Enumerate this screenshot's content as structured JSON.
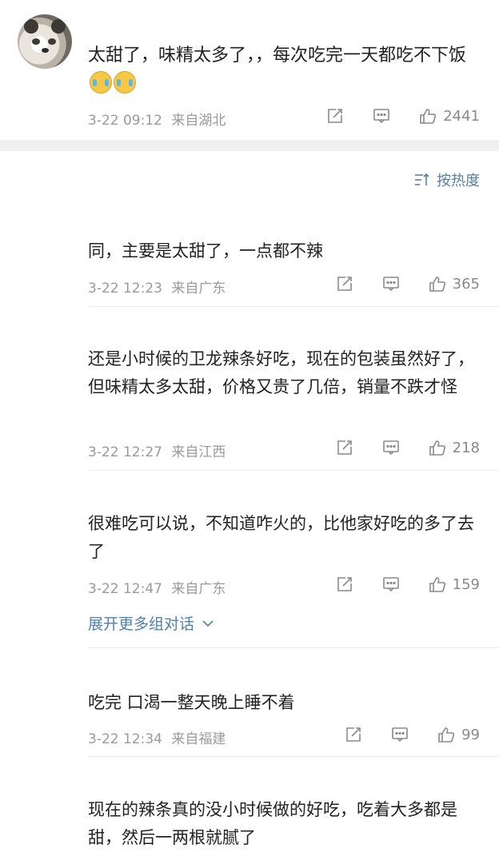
{
  "main_comment": {
    "text": "太甜了，味精太多了，，每次吃完一天都吃不下饭",
    "emoji": [
      "crying-laughing-emoji",
      "crying-laughing-emoji"
    ],
    "time": "3-22 09:12",
    "location": "来自湖北",
    "likes": "2441"
  },
  "sort": {
    "label": "按热度"
  },
  "replies": [
    {
      "text": "同，主要是太甜了，一点都不辣",
      "time": "3-22 12:23",
      "location": "来自广东",
      "likes": "365"
    },
    {
      "text": "还是小时候的卫龙辣条好吃，现在的包装虽然好了，但味精太多太甜，价格又贵了几倍，销量不跌才怪",
      "time": "3-22 12:27",
      "location": "来自江西",
      "likes": "218"
    },
    {
      "text": "很难吃可以说，不知道咋火的，比他家好吃的多了去了",
      "time": "3-22 12:47",
      "location": "来自广东",
      "likes": "159"
    },
    {
      "text": "吃完 口渴一整天晚上睡不着",
      "time": "3-22 12:34",
      "location": "来自福建",
      "likes": "99"
    },
    {
      "text": "现在的辣条真的没小时候做的好吃，吃着大多都是甜，然后一两根就腻了"
    }
  ],
  "expand": {
    "label": "展开更多组对话"
  },
  "colors": {
    "link": "#4f7fb3",
    "meta": "#9a9a9a",
    "separator": "#f0f0f0"
  }
}
